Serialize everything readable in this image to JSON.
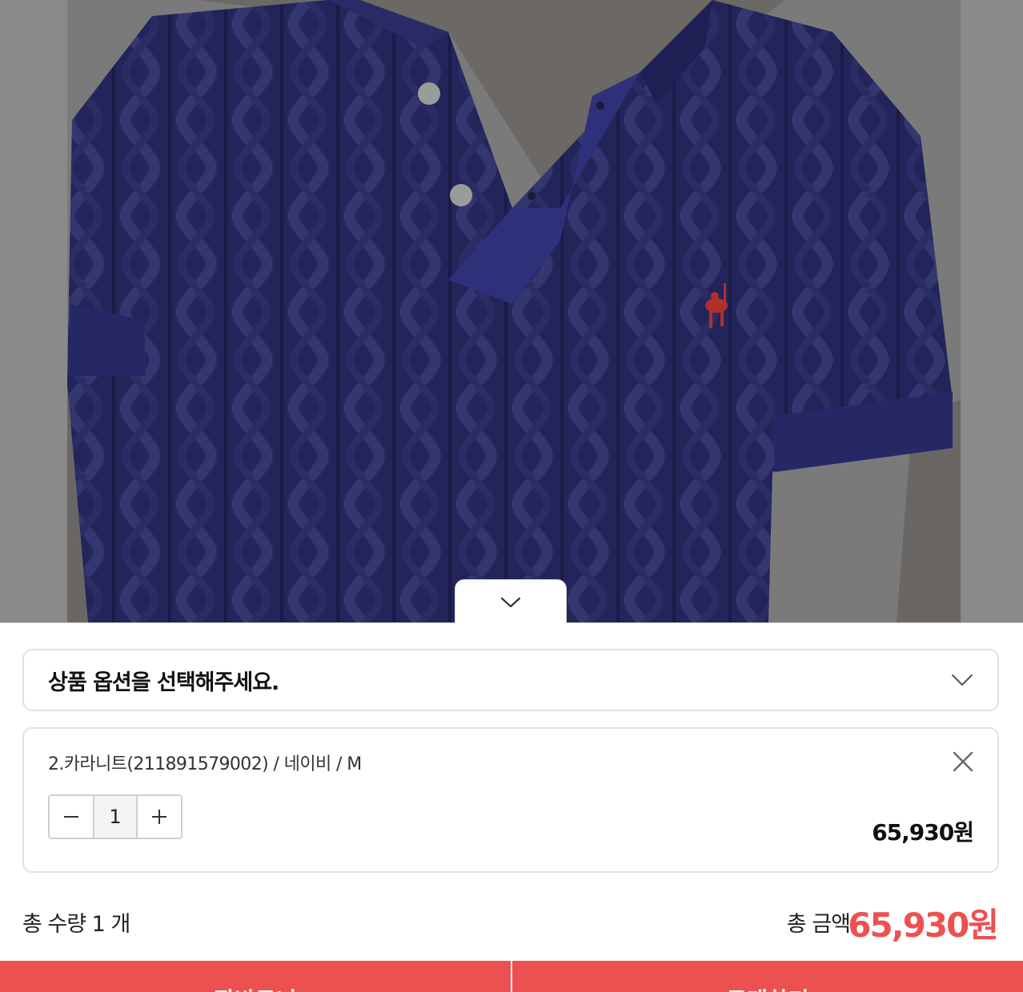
{
  "photo": {
    "alt": "navy cable-knit polo",
    "knit_color": "#23245a",
    "backdrop_color": "#7b7b7b",
    "logo_color": "#b0302a"
  },
  "collapse_tab": {
    "icon": "chevron-down-icon"
  },
  "option_select": {
    "placeholder": "상품 옵션을 선택해주세요.",
    "icon": "chevron-down-icon"
  },
  "selected_item": {
    "name": "2.카라니트(211891579002) / 네이비 / M",
    "quantity": "1",
    "price": "65,930원",
    "remove_icon": "close-icon",
    "decrement_icon": "minus-icon",
    "increment_icon": "plus-icon"
  },
  "summary": {
    "total_quantity": "총 수량 1 개",
    "total_label": "총 금액",
    "total_price": "65,930원"
  },
  "actions": {
    "cart": "장바구니",
    "buy": "구매하기"
  },
  "colors": {
    "accent": "#ec5150",
    "border": "#e3e3e3"
  }
}
